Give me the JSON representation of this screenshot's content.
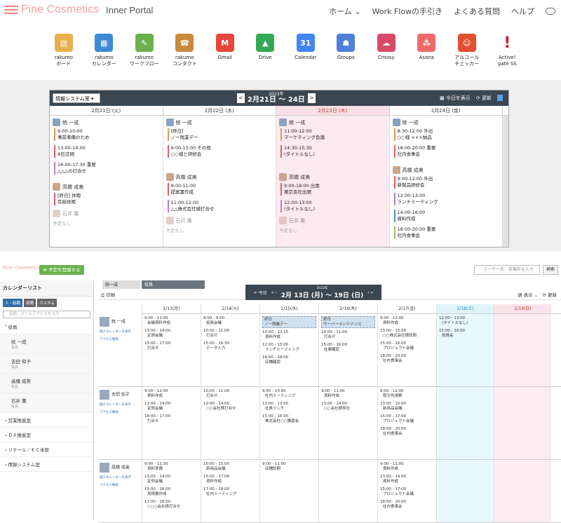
{
  "header": {
    "logo": "Pine Cosmetics",
    "subtitle": "Inner Portal",
    "nav": [
      "ホーム",
      "Work Flowの手引き",
      "よくある質問",
      "ヘルプ"
    ]
  },
  "apps": [
    {
      "label1": "rakumo",
      "label2": "ボード",
      "icon": "board-icon",
      "color": "#e8b04c"
    },
    {
      "label1": "rakumo",
      "label2": "カレンダー",
      "icon": "calendar-icon",
      "color": "#3f8ad6"
    },
    {
      "label1": "rakumo",
      "label2": "ワークフロー",
      "icon": "workflow-icon",
      "color": "#6ab04c"
    },
    {
      "label1": "rakumo",
      "label2": "コンタクト",
      "icon": "contact-icon",
      "color": "#c98a3c"
    },
    {
      "label1": "Gmail",
      "label2": "",
      "icon": "gmail-icon",
      "color": "#e8453c"
    },
    {
      "label1": "Drive",
      "label2": "",
      "icon": "drive-icon",
      "color": "#34a853"
    },
    {
      "label1": "Calendar",
      "label2": "",
      "icon": "google-calendar-icon",
      "color": "#4285f4"
    },
    {
      "label1": "Groups",
      "label2": "",
      "icon": "groups-icon",
      "color": "#4f7fd9"
    },
    {
      "label1": "Cmosy",
      "label2": "",
      "icon": "cmosy-icon",
      "color": "#d94a6a"
    },
    {
      "label1": "Asana",
      "label2": "",
      "icon": "asana-icon",
      "color": "#f06a6a"
    },
    {
      "label1": "アルコール",
      "label2": "チェッカー",
      "icon": "alcohol-checker-icon",
      "color": "#e05030"
    },
    {
      "label1": "Active!",
      "label2": "gate SS",
      "icon": "active-gate-icon",
      "color": "#d0202a"
    }
  ],
  "week": {
    "group": "情報システム室",
    "year": "2023年",
    "range": "2月21日 ～ 24日",
    "today": "今日を表示",
    "refresh": "更新",
    "days": [
      "2月21日 (火)",
      "2月22日 (水)",
      "2月23日 (木)",
      "2月24日 (金)"
    ],
    "p1": "统 一成",
    "p2": "高橋 成美",
    "p3": "石井 薫",
    "none": "予定なし",
    "d1": [
      [
        "9:00-10:00",
        "事前準備のため"
      ],
      [
        "13:00-14:00",
        "A社訪問"
      ],
      [
        "16:00-17:30 重要",
        "△△△の打合せ"
      ]
    ],
    "d1b": [
      [
        "[終日] 休暇",
        "有給休暇"
      ]
    ],
    "d2": [
      [
        "[終日]",
        "ノー残業デー"
      ],
      [
        "9:00-15:00 その他",
        "○○様と研修会"
      ]
    ],
    "d2b": [
      [
        "9:00-11:00",
        "提案書作成"
      ],
      [
        "11:00-12:00",
        "△△株式会社様打合せ"
      ]
    ],
    "d3": [
      [
        "11:00-12:00",
        "マーケティング会議"
      ],
      [
        "14:30-15:30",
        "(タイトルなし)"
      ]
    ],
    "d3b": [
      [
        "9:00-18:00 出張",
        "東京支社出張"
      ],
      [
        "12:00-13:00",
        "(タイトルなし)"
      ]
    ],
    "d4": [
      [
        "8:30-12:00 外出",
        "○○様 ×××納品"
      ],
      [
        "18:00-20:00 重要",
        "社内食事会"
      ]
    ],
    "d4b": [
      [
        "9:00-12:00 外出",
        "新製品研修会"
      ],
      [
        "12:00-13:00",
        "ランチミーティング"
      ],
      [
        "14:00-16:00",
        "資料作成"
      ],
      [
        "18:00-20:00 重要",
        "社内食事会"
      ]
    ]
  },
  "multi": {
    "register": "予定を登録する",
    "search_placeholder": "ユーザー名、設備名を入力",
    "search_btn": "検索",
    "list_title": "カレンダーリスト",
    "tabs": [
      "人・組織",
      "設備",
      "カスタム"
    ],
    "filter_placeholder": "名前、メールアドレスを入力",
    "officer": "役員",
    "members": [
      {
        "n": "统 一成",
        "r": "役員"
      },
      {
        "n": "吉田 知子",
        "r": "役員"
      },
      {
        "n": "高橋 成美",
        "r": "役員"
      },
      {
        "n": "石井 薫",
        "r": "役員"
      }
    ],
    "groups": [
      "営業推進室",
      "ＤＸ推進室",
      "リテール／ＥＣ本部",
      "情報システム室"
    ],
    "mtab1": "统一成",
    "mtab2": "役員",
    "print": "印刷",
    "today": "今日",
    "year": "2023年",
    "range": "2月 13日 (月) ～ 19日 (日)",
    "view": "週 表示",
    "refresh": "更新",
    "days": [
      "2/13(月)",
      "2/14(火)",
      "2/15(水)",
      "2/16(木)",
      "2/17(金)",
      "2/18(土)",
      "2/19(日)"
    ],
    "show_personal": "個人カレンダーを表示",
    "access": "アクセス権限",
    "rows": [
      {
        "name": "统 一成",
        "cells": [
          [
            [
              "9:00 - 11:00",
              "会議資料作成"
            ],
            [
              "13:00 - 14:00",
              "定例会議"
            ],
            [
              "15:00 - 17:00",
              "打合せ"
            ]
          ],
          [
            [
              "8:00 - 9:00",
              "役員会議"
            ],
            [
              "10:00 - 11:00",
              "打合せ"
            ],
            [
              "15:00 - 16:30",
              "データ入力"
            ]
          ],
          [
            [
              "終日",
              "ノー残業デー"
            ],
            [
              "10:00 - 12:15",
              "資料作成"
            ],
            [
              "12:00 - 13:00",
              "ランチミーティング"
            ],
            [
              "16:00 - 18:00",
              "店舗確認"
            ]
          ],
          [
            [
              "終日",
              "サーバーメンテナンス"
            ],
            [
              "10:00 - 11:00",
              "打合せ"
            ],
            [
              "15:00 - 16:00",
              "在庫確認"
            ]
          ],
          [
            [
              "9:00 - 12:00",
              "資料作成"
            ],
            [
              "13:00 - 15:00",
              "○○株式会社様訪問"
            ],
            [
              "15:00 - 16:00",
              "プロジェクト会議"
            ],
            [
              "18:00 - 20:00",
              "社内食事会"
            ]
          ],
          [
            [
              "12:00 - 13:00",
              "(タイトルなし)"
            ],
            [
              "15:00 - 16:00",
              "役員会"
            ]
          ],
          []
        ]
      },
      {
        "name": "吉田 知子",
        "cells": [
          [
            [
              "9:00 - 12:00",
              "資料作成"
            ],
            [
              "13:00 - 14:00",
              "定例会議"
            ],
            [
              "16:00 - 17:00",
              "打合せ"
            ]
          ],
          [
            [
              "10:00 - 11:00",
              "打合せ"
            ],
            [
              "12:00 - 14:00",
              "○○会社様打合せ"
            ]
          ],
          [
            [
              "9:00 - 10:00",
              "社内ミーティング"
            ],
            [
              "12:00 - 13:00",
              "社員ランチ"
            ],
            [
              "15:00 - 16:00",
              "株式会社○○講習会"
            ]
          ],
          [
            [
              "9:00 - 11:00",
              "資料作成"
            ],
            [
              "13:00 - 14:00",
              "○○会社様来社"
            ]
          ],
          [
            [
              "9:00 - 12:00",
              "取引先視察"
            ],
            [
              "13:00 - 15:00",
              "新商品会議"
            ],
            [
              "15:00 - 17:00",
              "プロジェクト会議"
            ],
            [
              "18:00 - 20:00",
              "社内食事会"
            ]
          ],
          [],
          []
        ]
      },
      {
        "name": "高橋 成美",
        "cells": [
          [
            [
              "9:00 - 11:30",
              "資料準備"
            ],
            [
              "13:00 - 14:00",
              "定例会議"
            ],
            [
              "15:00 - 16:00",
              "見積書作成"
            ],
            [
              "17:00 - 18:00",
              "○○○会社様打合せ"
            ]
          ],
          [
            [
              "10:00 - 15:00",
              "新商品会議"
            ],
            [
              "15:00 - 17:00",
              "資料作成"
            ],
            [
              "17:00 - 18:00",
              "社内ミーティング"
            ]
          ],
          [
            [
              "9:00 - 11:00",
              "店舗訪問"
            ]
          ],
          [],
          [
            [
              "9:00 - 11:00",
              "資料作成"
            ],
            [
              "13:00 - 14:00",
              "資料作成"
            ],
            [
              "15:00 - 17:00",
              "プロジェクト会議"
            ],
            [
              "18:00 - 20:00",
              "社内食事会"
            ]
          ],
          [],
          []
        ]
      }
    ]
  }
}
